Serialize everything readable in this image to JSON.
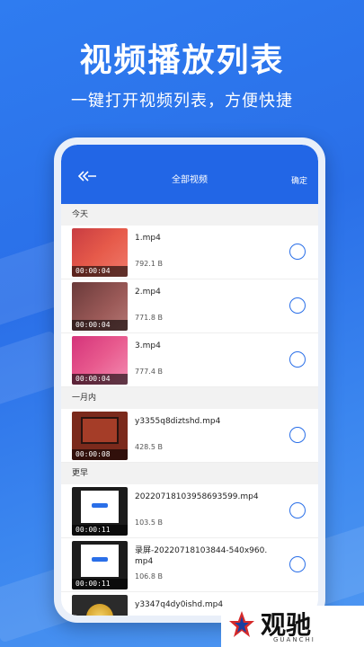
{
  "hero": {
    "title": "视频播放列表",
    "subtitle": "一键打开视频列表，方便快捷"
  },
  "app": {
    "title": "全部视频",
    "back_icon": "double-chevron-left-icon",
    "confirm_label": "确定",
    "accent_color": "#2266e6"
  },
  "sections": [
    {
      "label": "今天",
      "items": [
        {
          "name": "1.mp4",
          "size": "792.1 B",
          "duration": "00:00:04"
        },
        {
          "name": "2.mp4",
          "size": "771.8 B",
          "duration": "00:00:04"
        },
        {
          "name": "3.mp4",
          "size": "777.4 B",
          "duration": "00:00:04"
        }
      ]
    },
    {
      "label": "一月内",
      "items": [
        {
          "name": "y3355q8diztshd.mp4",
          "size": "428.5 B",
          "duration": "00:00:08"
        }
      ]
    },
    {
      "label": "更早",
      "items": [
        {
          "name": "20220718103958693599.mp4",
          "size": "103.5 B",
          "duration": "00:00:11"
        },
        {
          "name": "录屏-20220718103844-540x960.mp4",
          "size": "106.8 B",
          "duration": "00:00:11"
        },
        {
          "name": "y3347q4dy0ishd.mp4",
          "size": "",
          "duration": ""
        }
      ]
    }
  ],
  "watermark": {
    "brand": "观驰",
    "sub": "GUANCHI"
  }
}
